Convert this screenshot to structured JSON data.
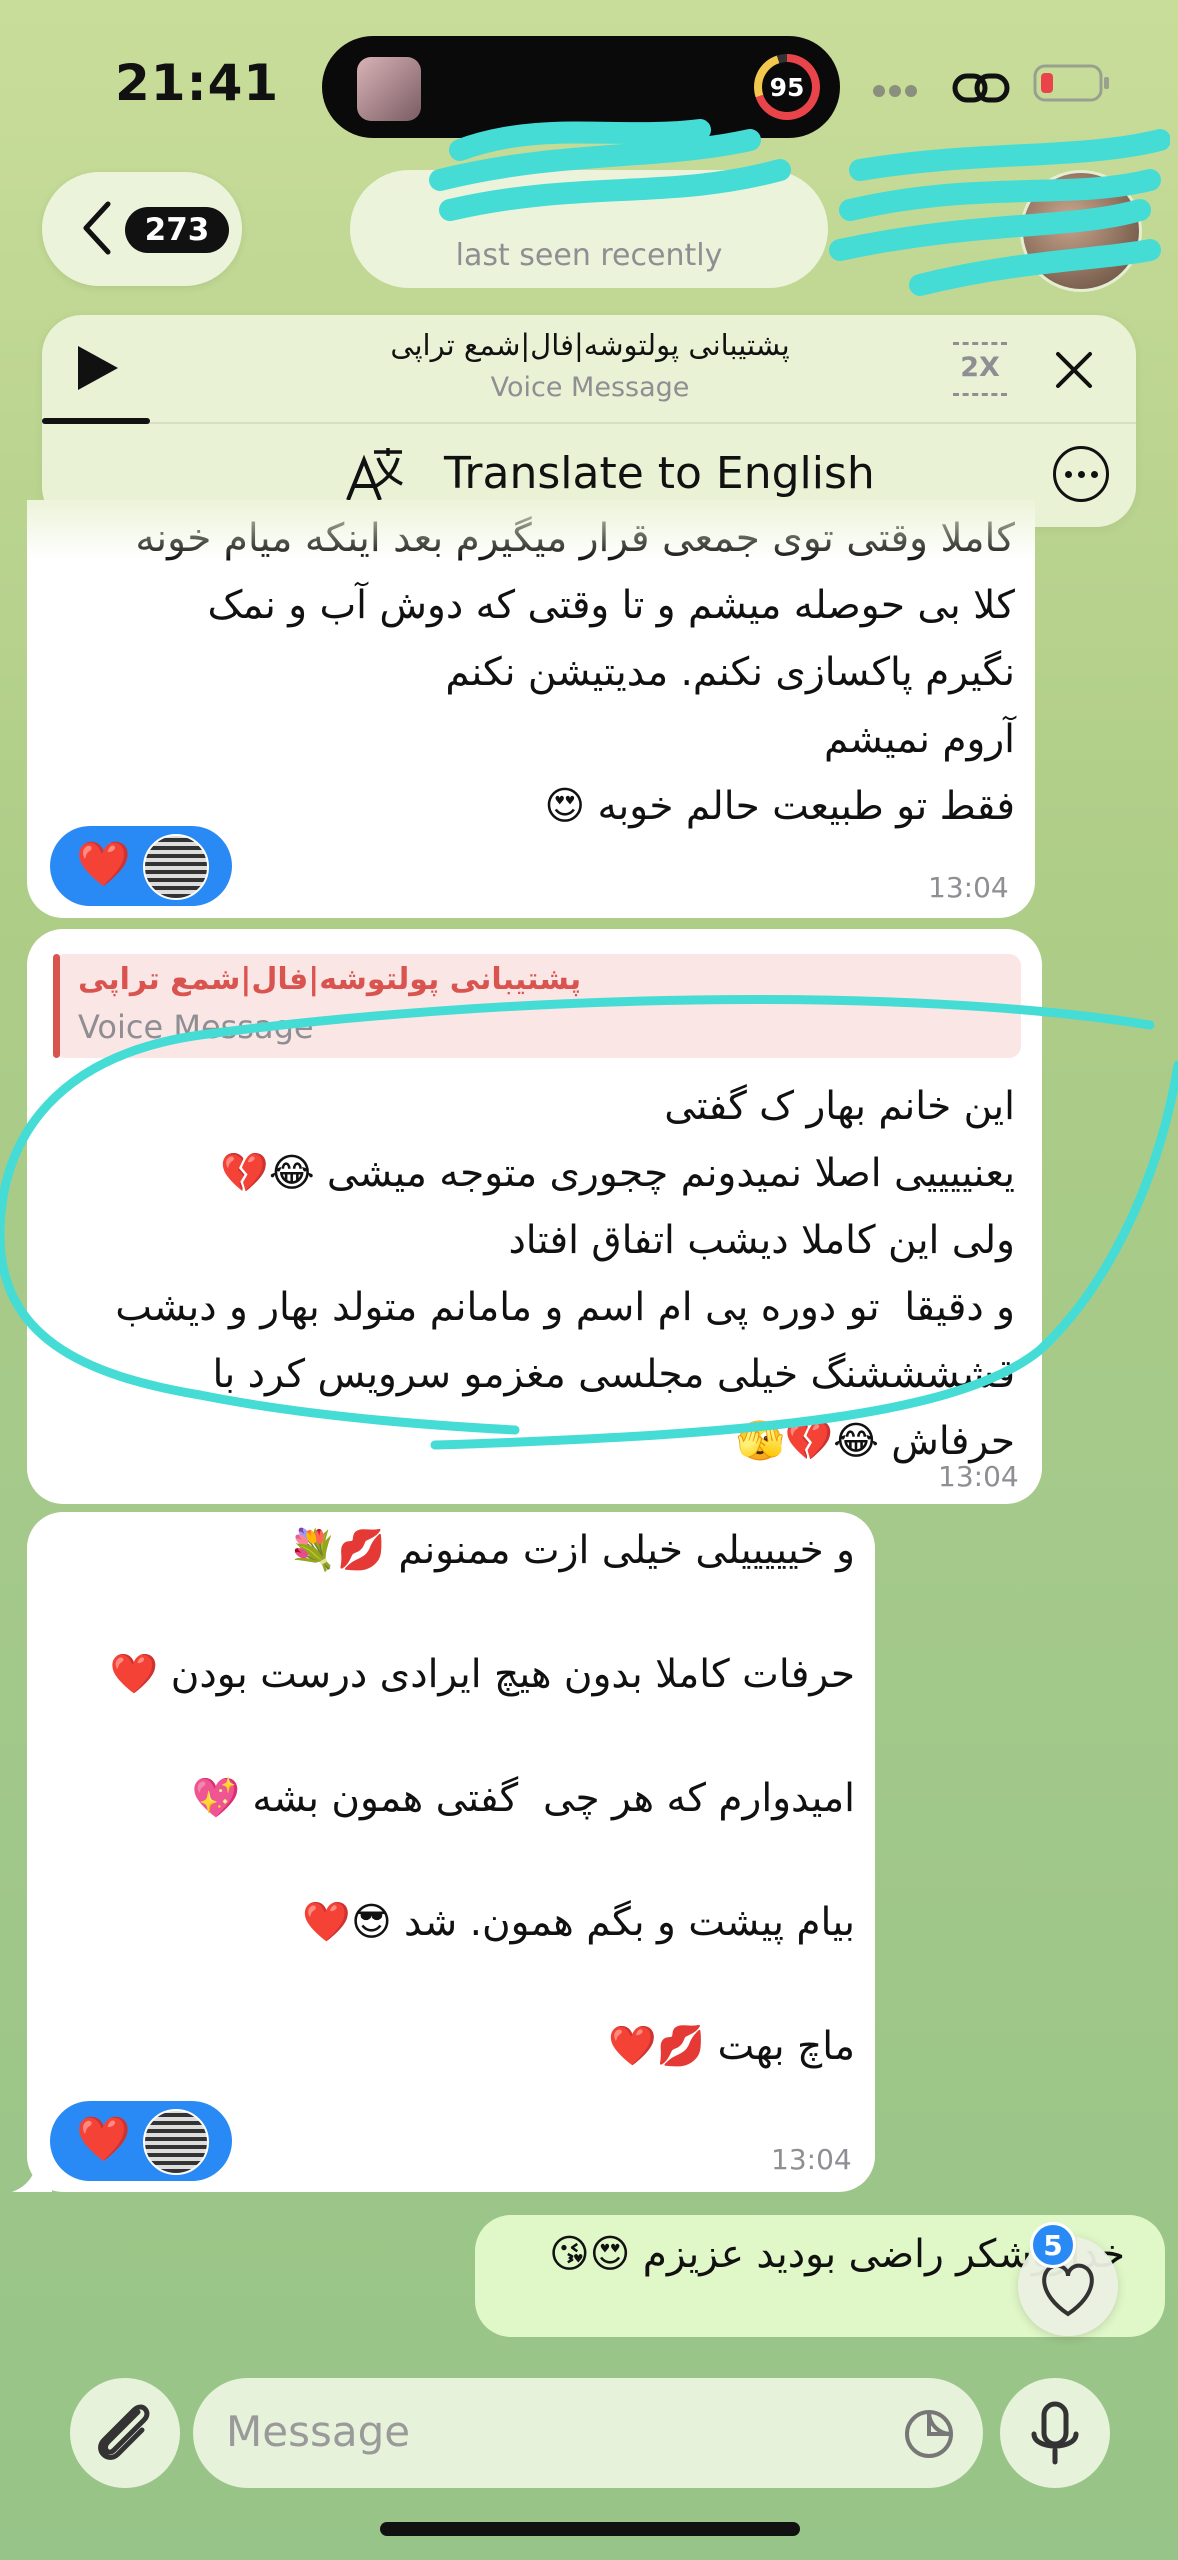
{
  "status_bar": {
    "time": "21:41",
    "activity_ring_value": "95"
  },
  "header": {
    "back_count": "273",
    "last_seen": "last seen recently"
  },
  "player": {
    "title": "پشتیبانی پولتوشه|فال|شمع تراپی",
    "subtitle": "Voice Message",
    "speed": "2X",
    "translate_label": "Translate to English"
  },
  "messages": [
    {
      "text": "کاملا وقتی توی جمعی قرار میگیرم بعد اینکه میام خونه\nکلا بی حوصله میشم و تا وقتی که دوش آب و نمک\nنگیرم پاکسازی نکنم. مدیتیشن نکنم\nآروم نمیشم\nفقط تو طبیعت حالم خوبه 😍",
      "time": "13:04",
      "reaction": "❤️"
    },
    {
      "reply_title": "پشتیبانی پولتوشه|فال|شمع تراپی",
      "reply_subtitle": "Voice Message",
      "text": "این خانم بهار ک گفتی\nیعنییییی اصلا نمیدونم چجوری متوجه میشی 😂💔\nولی این کاملا دیشب اتفاق افتاد\nو دقیقا  تو دوره پی ام اسم و مامانم متولد بهار و دیشب\nقششششنگ خیلی مجلسی مغزمو سرویس کرد با\nحرفاش 😂💔🫣",
      "time": "13:04"
    },
    {
      "text": "و خیییییلی خیلی ازت ممنونم 💋💐\n\nحرفات کاملا بدون هیچ ایرادی درست بودن ❤️\n\nامیدوارم که هر چی  گفتی همون بشه 💖\n\nبیام پیشت و بگم همون. شد 😎❤️\n\nماچ بهت 💋❤️",
      "time": "13:04",
      "reaction": "❤️"
    }
  ],
  "outgoing": {
    "text": "خداروشکر راضی بودید عزیزم 😍😘"
  },
  "floating_badge": "5",
  "composer": {
    "placeholder": "Message"
  },
  "colors": {
    "accent_blue": "#2a8af5",
    "reply_red": "#d9534f",
    "scribble": "#45dcd6"
  }
}
